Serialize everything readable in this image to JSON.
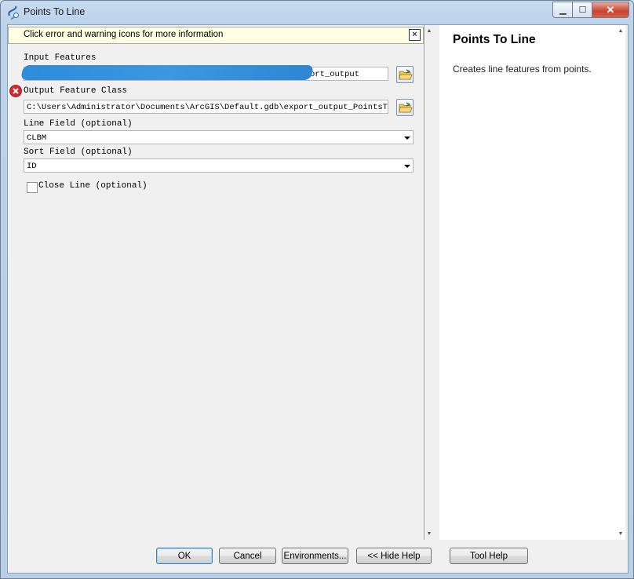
{
  "window": {
    "title": "Points To Line",
    "controls": {
      "minimize": "minimize",
      "maximize": "maximize",
      "close": "close"
    }
  },
  "message_bar": {
    "text": "Click error and warning icons for more information"
  },
  "fields": {
    "input_features": {
      "label": "Input Features",
      "value": "ort_output"
    },
    "output_feature_class": {
      "label": "Output Feature Class",
      "value": "C:\\Users\\Administrator\\Documents\\ArcGIS\\Default.gdb\\export_output_PointsToLi:",
      "status": "error"
    },
    "line_field": {
      "label": "Line Field (optional)",
      "value": "CLBM"
    },
    "sort_field": {
      "label": "Sort Field (optional)",
      "value": "ID"
    },
    "close_line": {
      "label": "Close Line (optional)",
      "checked": false
    }
  },
  "help": {
    "title": "Points To Line",
    "description": "Creates line features from points."
  },
  "buttons": {
    "ok": "OK",
    "cancel": "Cancel",
    "environments": "Environments...",
    "hide_help": "<< Hide Help",
    "tool_help": "Tool Help"
  },
  "colors": {
    "accent": "#3c7fb1",
    "error": "#d9262e",
    "message_bg": "#ffffe1",
    "redaction": "#2e8bd8"
  }
}
